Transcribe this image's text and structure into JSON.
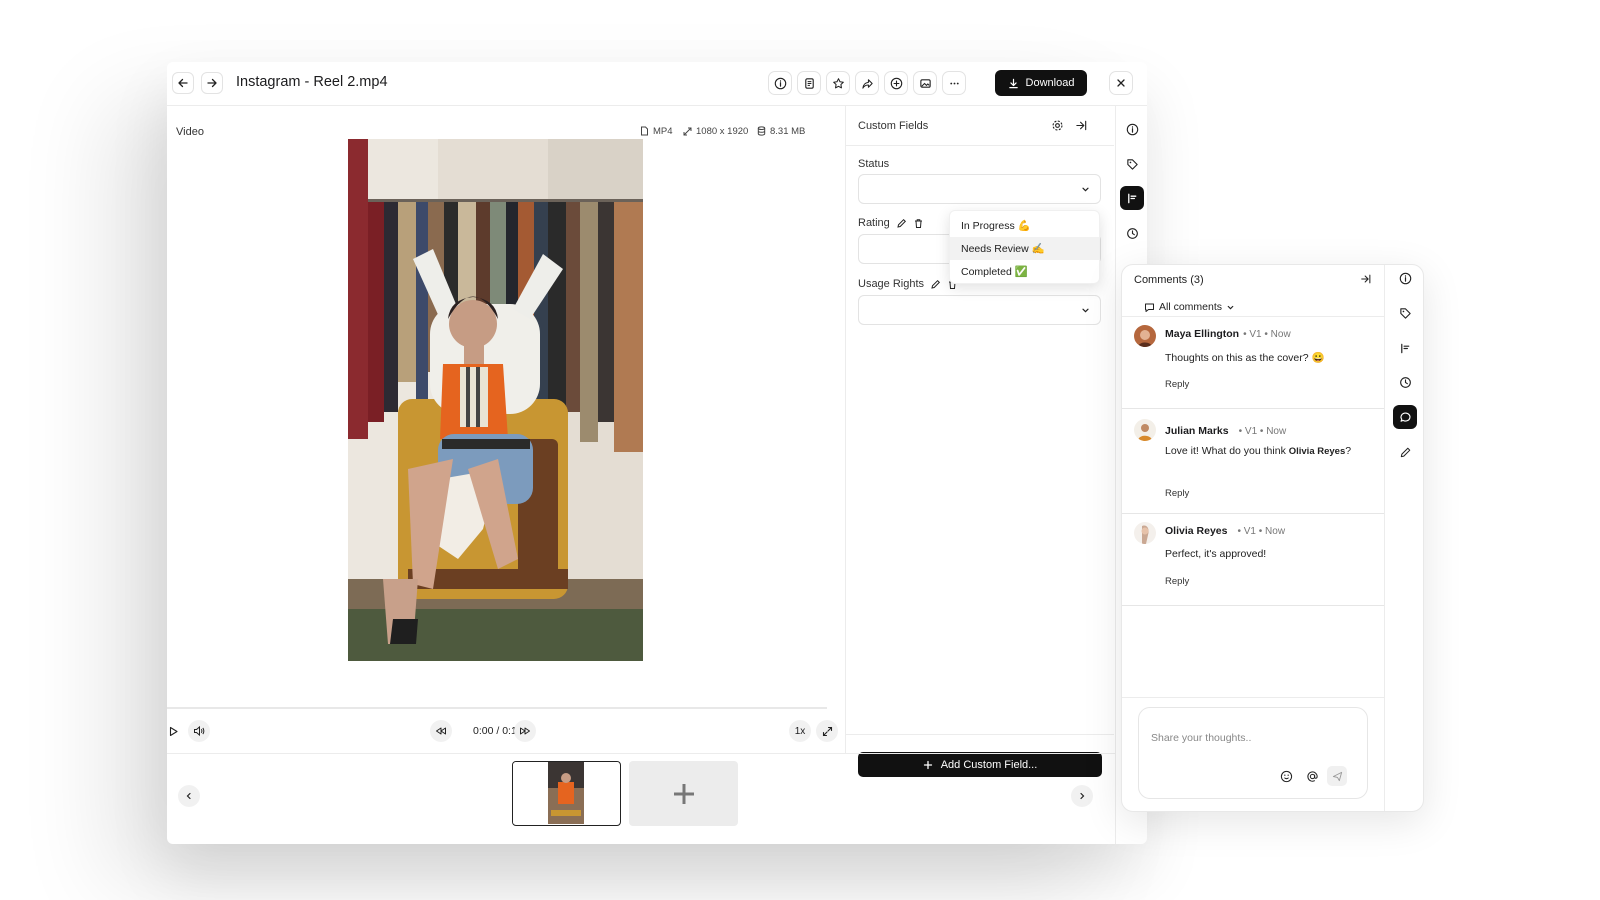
{
  "header": {
    "title": "Instagram - Reel 2.mp4",
    "download_label": "Download"
  },
  "video": {
    "section_label": "Video",
    "format": "MP4",
    "dimensions": "1080 x 1920",
    "file_size": "8.31 MB",
    "timecode": "0:00 / 0:12",
    "speed": "1x",
    "progress": 0
  },
  "custom_fields": {
    "title": "Custom Fields",
    "status_label": "Status",
    "rating_label": "Rating",
    "usage_rights_label": "Usage Rights",
    "dropdown_options": [
      {
        "label": "In Progress",
        "emoji": "💪"
      },
      {
        "label": "Needs Review",
        "emoji": "✍️"
      },
      {
        "label": "Completed",
        "emoji": "✅"
      }
    ],
    "add_button_label": "Add Custom Field..."
  },
  "comments": {
    "title": "Comments (3)",
    "filter_label": "All comments",
    "items": [
      {
        "name": "Maya Ellington",
        "meta": "• V1 • Now",
        "text": "Thoughts on this as the cover? 😀",
        "reply": "Reply"
      },
      {
        "name": "Julian Marks",
        "meta": "• V1 • Now",
        "text_prefix": "Love it! What do you think ",
        "mention": "Olivia Reyes",
        "text_suffix": "?",
        "reply": "Reply"
      },
      {
        "name": "Olivia Reyes",
        "meta": "• V1 • Now",
        "text": "Perfect, it's approved!",
        "reply": "Reply"
      }
    ],
    "compose_placeholder": "Share your thoughts.."
  },
  "colors": {
    "primary_button": "#111111",
    "border": "#e3e3e3",
    "accent_orange": "#e8662f"
  },
  "icons": {
    "nav": [
      "arrow-left-icon",
      "arrow-right-icon"
    ],
    "toolbar": [
      "info-icon",
      "file-icon",
      "star-icon",
      "share-icon",
      "plus-circle-icon",
      "image-icon",
      "more-icon"
    ],
    "rail": [
      "info-icon",
      "tag-icon",
      "fields-icon",
      "history-icon",
      "comment-icon",
      "pencil-icon"
    ]
  }
}
